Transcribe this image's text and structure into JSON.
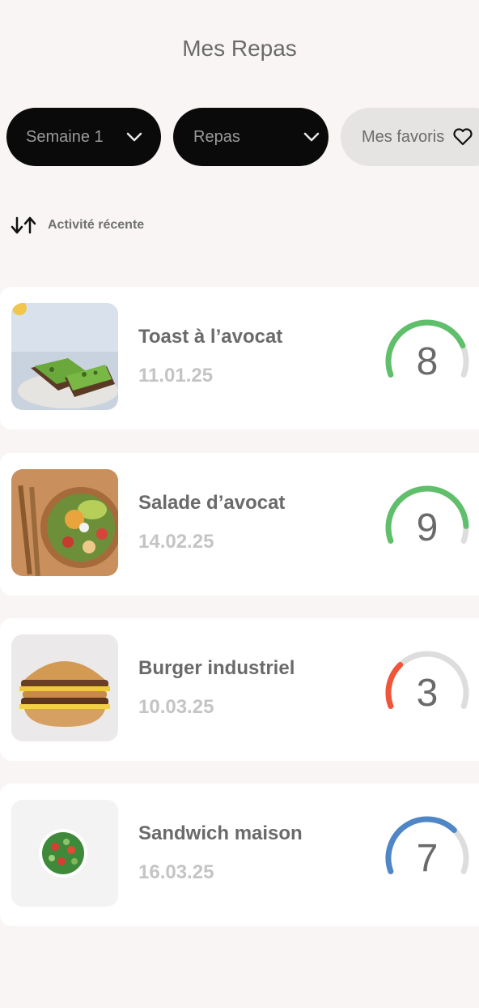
{
  "page": {
    "title": "Mes Repas"
  },
  "filters": {
    "week": "Semaine 1",
    "category": "Repas",
    "favorites": "Mes favoris"
  },
  "sort": {
    "label": "Activité récente",
    "icon": "sort-arrows-icon"
  },
  "meals": [
    {
      "name": "Toast à l’avocat",
      "date": "11.01.25",
      "score": "8",
      "score_fraction": 0.8,
      "color": "#5fbf6a"
    },
    {
      "name": "Salade d’avocat",
      "date": "14.02.25",
      "score": "9",
      "score_fraction": 0.9,
      "color": "#5fbf6a"
    },
    {
      "name": "Burger industriel",
      "date": "10.03.25",
      "score": "3",
      "score_fraction": 0.3,
      "color": "#f0553a"
    },
    {
      "name": "Sandwich maison",
      "date": "16.03.25",
      "score": "7",
      "score_fraction": 0.7,
      "color": "#4f86c6"
    }
  ],
  "colors": {
    "track": "#dddddd",
    "pill_dark": "#0a0a0a",
    "pill_light": "#e6e4e3"
  }
}
